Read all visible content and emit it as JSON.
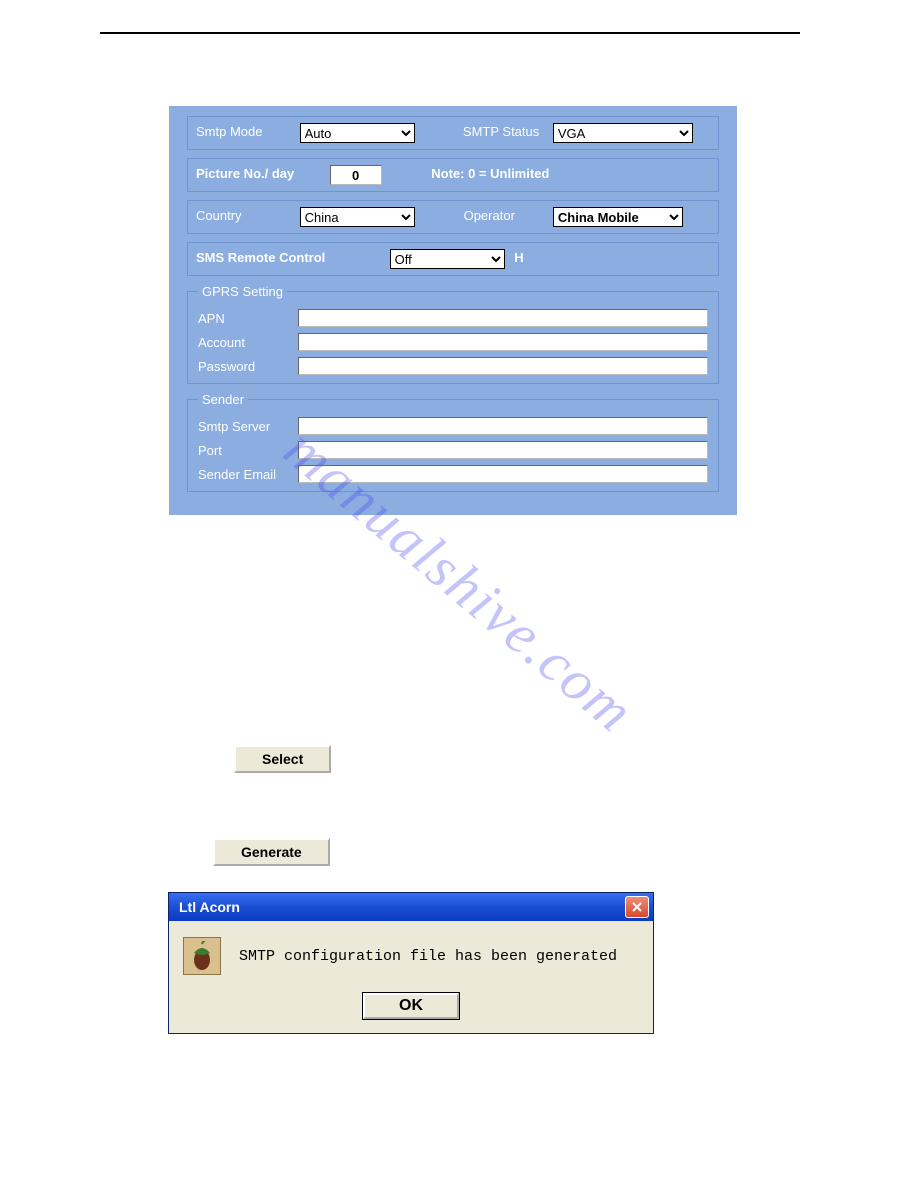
{
  "watermark": "manualshive.com",
  "panel": {
    "row1": {
      "smtp_mode_label": "Smtp Mode",
      "smtp_mode_value": "Auto",
      "smtp_status_label": "SMTP Status",
      "smtp_status_value": "VGA"
    },
    "row2": {
      "picture_label": "Picture No./ day",
      "picture_value": "0",
      "note": "Note: 0 = Unlimited"
    },
    "row3": {
      "country_label": "Country",
      "country_value": "China",
      "operator_label": "Operator",
      "operator_value": "China Mobile"
    },
    "row4": {
      "sms_label": "SMS Remote Control",
      "sms_value": "Off",
      "tail": "H"
    },
    "gprs": {
      "legend": "GPRS Setting",
      "apn_label": "APN",
      "apn_value": "",
      "account_label": "Account",
      "account_value": "",
      "password_label": "Password",
      "password_value": ""
    },
    "sender": {
      "legend": "Sender",
      "smtp_server_label": "Smtp Server",
      "smtp_server_value": "",
      "port_label": "Port",
      "port_value": "",
      "sender_email_label": "Sender Email",
      "sender_email_value": ""
    }
  },
  "buttons": {
    "select": "Select",
    "generate": "Generate"
  },
  "dialog": {
    "title": "Ltl Acorn",
    "message": "SMTP configuration file has been generated",
    "ok": "OK"
  }
}
